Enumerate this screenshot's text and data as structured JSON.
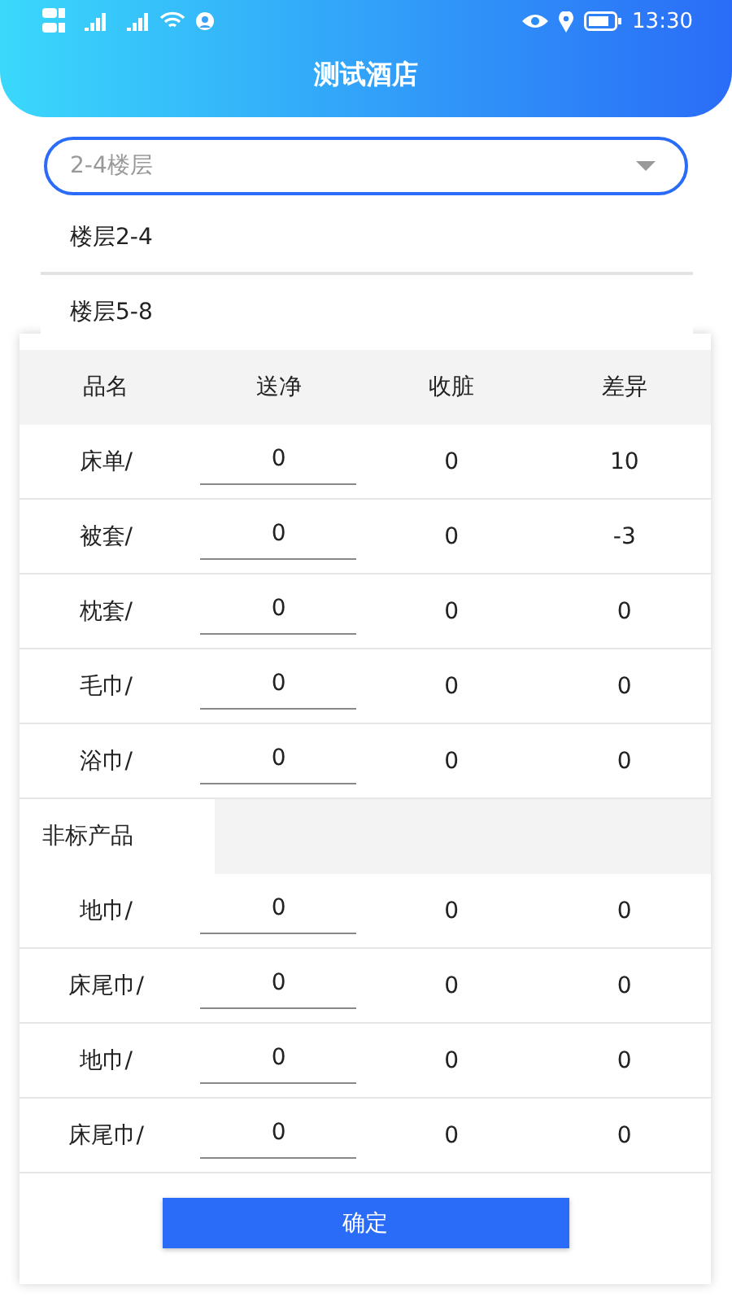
{
  "status_bar": {
    "time": "13:30"
  },
  "header": {
    "title": "测试酒店"
  },
  "floor_select": {
    "value": "2-4楼层",
    "expanded": true,
    "options": [
      {
        "label": "楼层2-4"
      },
      {
        "label": "楼层5-8"
      }
    ]
  },
  "table": {
    "columns": [
      "品名",
      "送净",
      "收脏",
      "差异"
    ],
    "sections": [
      {
        "rows": [
          {
            "name": "床单/",
            "clean": "0",
            "dirty": "0",
            "diff": "10"
          },
          {
            "name": "被套/",
            "clean": "0",
            "dirty": "0",
            "diff": "-3"
          },
          {
            "name": "枕套/",
            "clean": "0",
            "dirty": "0",
            "diff": "0"
          },
          {
            "name": "毛巾/",
            "clean": "0",
            "dirty": "0",
            "diff": "0"
          },
          {
            "name": "浴巾/",
            "clean": "0",
            "dirty": "0",
            "diff": "0"
          }
        ]
      },
      {
        "title": "非标产品",
        "rows": [
          {
            "name": "地巾/",
            "clean": "0",
            "dirty": "0",
            "diff": "0"
          },
          {
            "name": "床尾巾/",
            "clean": "0",
            "dirty": "0",
            "diff": "0"
          },
          {
            "name": "地巾/",
            "clean": "0",
            "dirty": "0",
            "diff": "0"
          },
          {
            "name": "床尾巾/",
            "clean": "0",
            "dirty": "0",
            "diff": "0"
          }
        ]
      }
    ]
  },
  "confirm_button": "确定"
}
